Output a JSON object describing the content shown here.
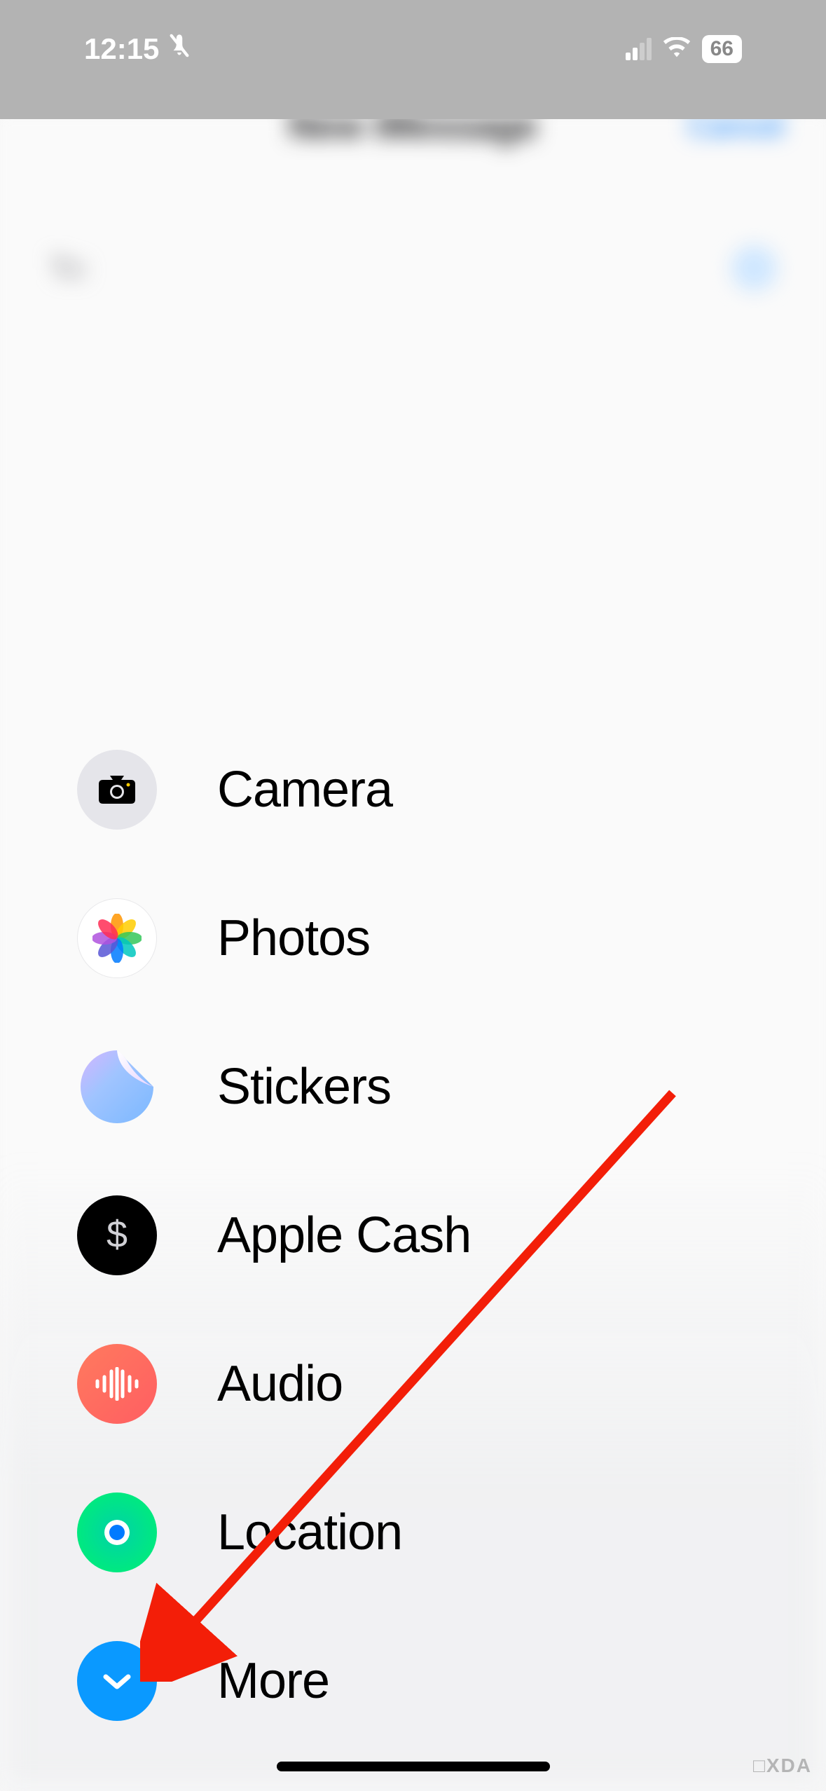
{
  "status_bar": {
    "time": "12:15",
    "battery": "66",
    "silent_mode": true
  },
  "background": {
    "title": "New iMessage",
    "cancel": "Cancel",
    "to_label": "To:"
  },
  "menu": {
    "items": [
      {
        "label": "Camera",
        "icon": "camera-icon"
      },
      {
        "label": "Photos",
        "icon": "photos-icon"
      },
      {
        "label": "Stickers",
        "icon": "stickers-icon"
      },
      {
        "label": "Apple Cash",
        "icon": "apple-cash-icon"
      },
      {
        "label": "Audio",
        "icon": "audio-icon"
      },
      {
        "label": "Location",
        "icon": "location-icon"
      },
      {
        "label": "More",
        "icon": "more-icon"
      }
    ]
  },
  "annotation": {
    "arrow_color": "#f31e08",
    "target": "more-button"
  },
  "watermark": "□XDA"
}
